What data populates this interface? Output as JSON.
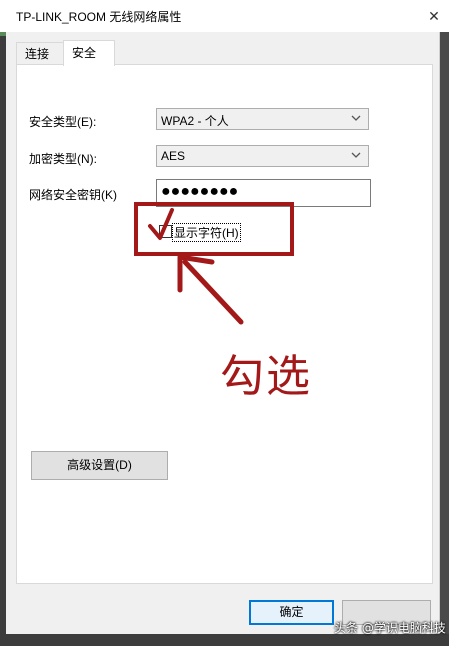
{
  "window": {
    "title": "TP-LINK_ROOM 无线网络属性",
    "close_glyph": "✕"
  },
  "tabs": [
    {
      "label": "连接"
    },
    {
      "label": "安全"
    }
  ],
  "form": {
    "security_type_label": "安全类型(E):",
    "security_type_value": "WPA2 - 个人",
    "encryption_type_label": "加密类型(N):",
    "encryption_type_value": "AES",
    "network_key_label": "网络安全密钥(K)",
    "network_key_value": "●●●●●●●●",
    "show_chars_label": "显示字符(H)",
    "show_chars_checked": false
  },
  "buttons": {
    "advanced_label": "高级设置(D)",
    "ok_label": "确定",
    "cancel_label": ""
  },
  "annotation": {
    "text": "勾选",
    "color": "#a31818"
  },
  "watermark": {
    "text": "头条 @学识电脑科技"
  },
  "icons": {
    "dropdown": "chevron-down-icon",
    "close": "close-icon",
    "check_mark": "check-mark-icon",
    "arrow": "arrow-icon"
  }
}
